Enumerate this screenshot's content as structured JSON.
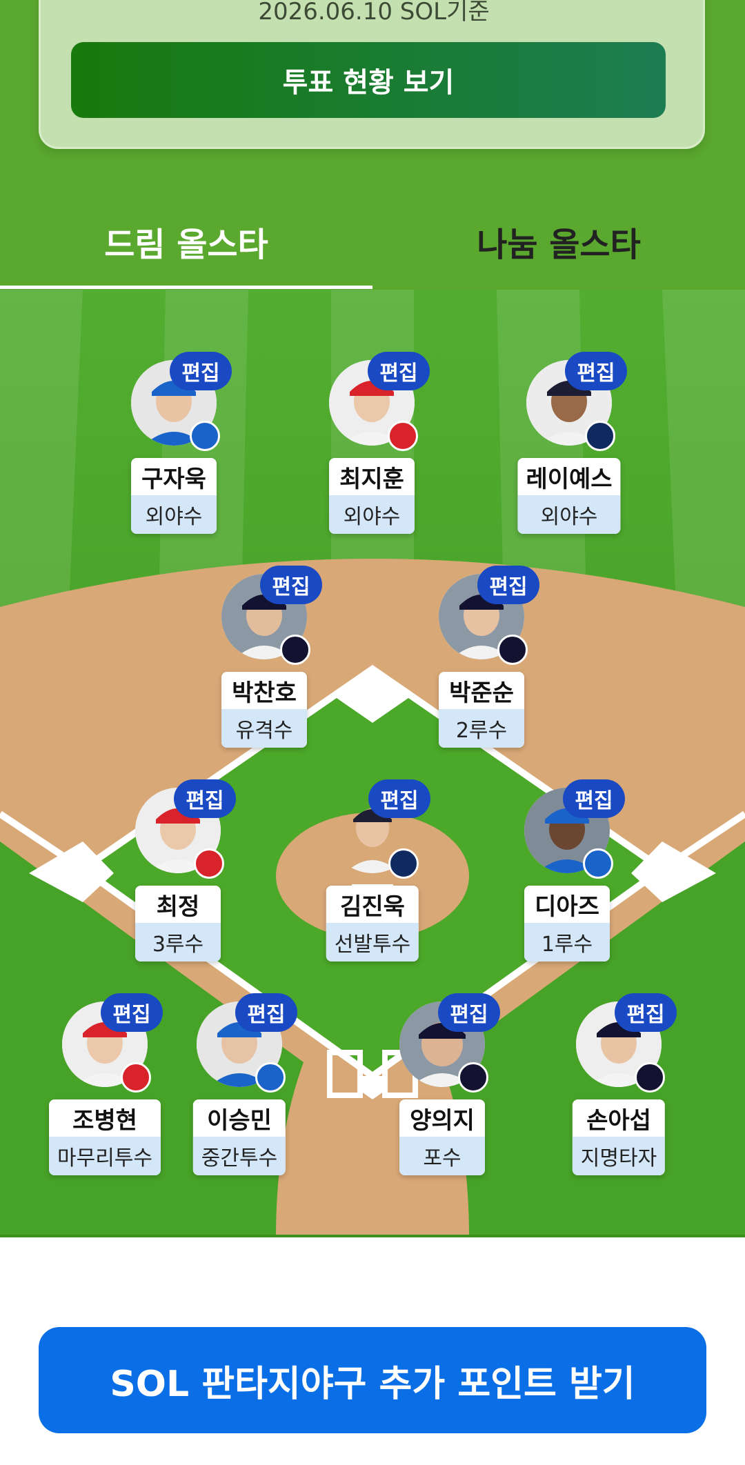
{
  "summary": {
    "date_text": "2026.06.10 SOL기준",
    "vote_button": "투표 현황 보기"
  },
  "tabs": [
    {
      "label": "드림 올스타",
      "active": true
    },
    {
      "label": "나눔 올스타",
      "active": false
    }
  ],
  "edit_label": "편집",
  "players": [
    {
      "name": "구자욱",
      "position": "외야수",
      "team_color": "#1a63c9"
    },
    {
      "name": "최지훈",
      "position": "외야수",
      "team_color": "#d8232a"
    },
    {
      "name": "레이예스",
      "position": "외야수",
      "team_color": "#0f2a5e"
    },
    {
      "name": "박찬호",
      "position": "유격수",
      "team_color": "#131230"
    },
    {
      "name": "박준순",
      "position": "2루수",
      "team_color": "#131230"
    },
    {
      "name": "최정",
      "position": "3루수",
      "team_color": "#d8232a"
    },
    {
      "name": "김진욱",
      "position": "선발투수",
      "team_color": "#0f2a5e"
    },
    {
      "name": "디아즈",
      "position": "1루수",
      "team_color": "#1a63c9"
    },
    {
      "name": "조병현",
      "position": "마무리투수",
      "team_color": "#d8232a"
    },
    {
      "name": "이승민",
      "position": "중간투수",
      "team_color": "#1a63c9"
    },
    {
      "name": "양의지",
      "position": "포수",
      "team_color": "#131230"
    },
    {
      "name": "손아섭",
      "position": "지명타자",
      "team_color": "#131230"
    }
  ],
  "cta_button": "SOL 판타지야구 추가 포인트 받기",
  "colors": {
    "field_green": "#4aa52a",
    "infield_dirt": "#d9a877",
    "edit_badge": "#1a49c4",
    "cta": "#0a6fe6"
  }
}
